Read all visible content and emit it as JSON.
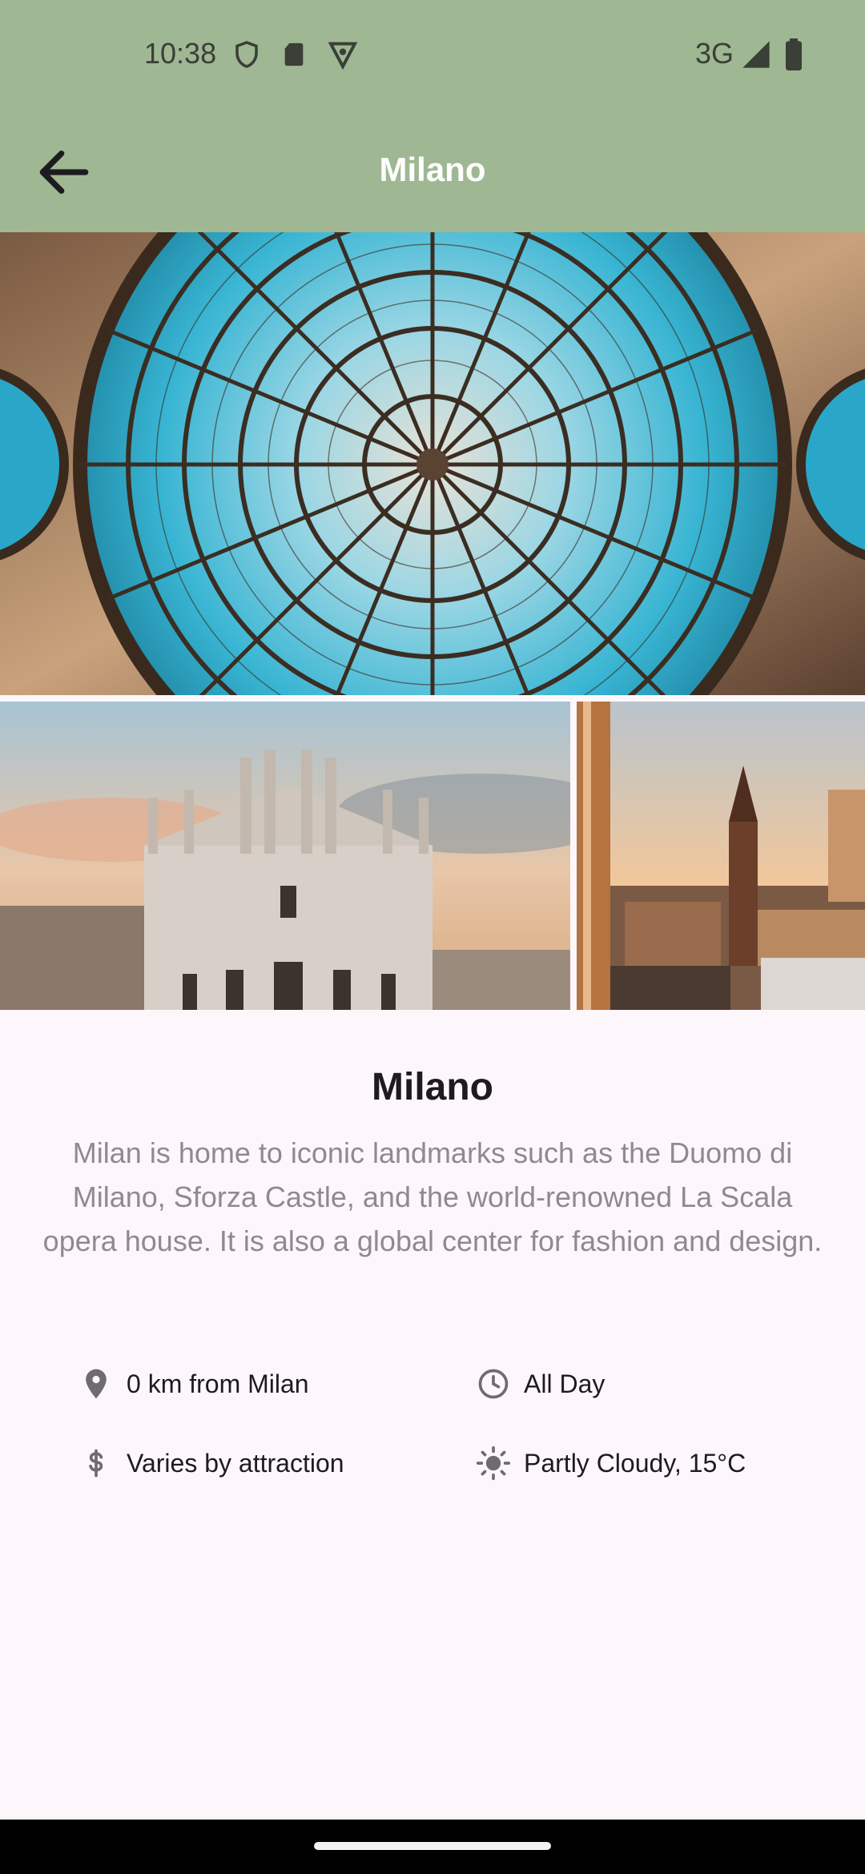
{
  "status_bar": {
    "time": "10:38",
    "network": "3G"
  },
  "header": {
    "title": "Milano"
  },
  "place": {
    "name": "Milano",
    "description": "Milan is home to iconic landmarks such as the Duomo di Milano, Sforza Castle, and the world-renowned La Scala opera house. It is also a global center for fashion and design."
  },
  "details": [
    {
      "icon": "location-pin-icon",
      "text": "0 km from Milan"
    },
    {
      "icon": "clock-icon",
      "text": "All Day"
    },
    {
      "icon": "dollar-icon",
      "text": "Varies by attraction"
    },
    {
      "icon": "sun-icon",
      "text": "Partly Cloudy, 15°C"
    }
  ],
  "colors": {
    "appbar": "#9fb893",
    "background": "#fdf7fb",
    "text_primary": "#1d1b20",
    "text_secondary": "#8f8a90"
  }
}
